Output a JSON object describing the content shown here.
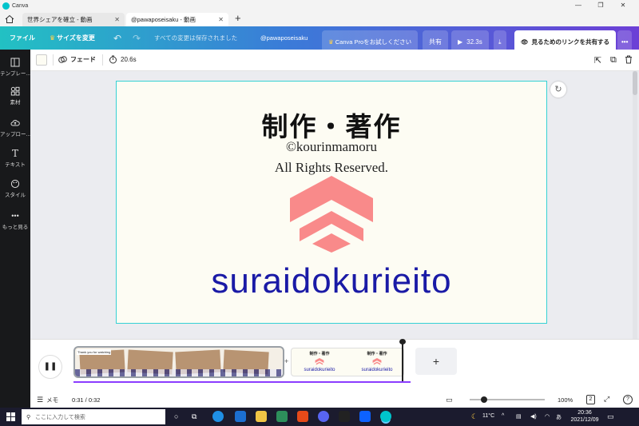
{
  "window": {
    "app_name": "Canva"
  },
  "tabs": [
    {
      "label": "世界シェアを確立 - 動画"
    },
    {
      "label": "@pawaposeisaku - 動画"
    }
  ],
  "toolbar": {
    "file": "ファイル",
    "resize": "サイズを変更",
    "saved_status": "すべての変更は保存されました",
    "project_name": "@pawaposeisaku",
    "try_pro": "Canva Proをお試しください",
    "share": "共有",
    "play_duration": "32.3s",
    "share_link": "見るためのリンクを共有する"
  },
  "sidebar": {
    "items": [
      {
        "label": "テンプレー..."
      },
      {
        "label": "素材"
      },
      {
        "label": "アップロー..."
      },
      {
        "label": "テキスト"
      },
      {
        "label": "スタイル"
      },
      {
        "label": "もっと見る"
      }
    ]
  },
  "editbar": {
    "transition": "フェード",
    "duration": "20.6s"
  },
  "slide": {
    "heading": "制作・著作",
    "copyright": "©kourinmamoru",
    "rights": "All Rights Reserved.",
    "brand": "suraidokurieito"
  },
  "timeline": {
    "thumb_heading": "制作・著作",
    "thumb_brand": "suraidokurieito",
    "thumb_caption": "Thank you for watching"
  },
  "bottombar": {
    "notes": "メモ",
    "time": "0:31 / 0:32",
    "zoom": "100%",
    "page_count": "2"
  },
  "taskbar": {
    "search_placeholder": "ここに入力して検索",
    "temperature": "11°C",
    "ime": "あ",
    "time": "20:36",
    "date": "2021/12/09"
  },
  "colors": {
    "accent": "#8b3dff",
    "brand_blue": "#1a1aa6",
    "logo_pink": "#f98a8a",
    "slide_border": "#35d1d4"
  }
}
